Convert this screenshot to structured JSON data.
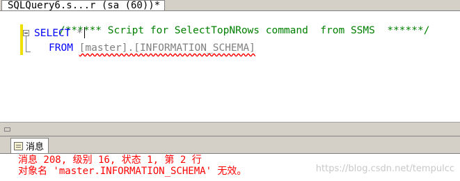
{
  "document_tab": {
    "title": "SQLQuery6.s...r (sa (60))*"
  },
  "editor": {
    "comment": "/****** Script for SelectTopNRows command  from SSMS  ******/",
    "select_keyword": "SELECT",
    "select_star": "*",
    "from_keyword": "FROM",
    "object_name": "[master].[INFORMATION_SCHEMA]"
  },
  "results": {
    "tab_label": "消息",
    "messages": [
      "消息 208, 级别 16, 状态 1, 第 2 行",
      "对象名 'master.INFORMATION_SCHEMA' 无效。"
    ],
    "message_color": "#ff0000"
  },
  "watermark": "https://blog.csdn.net/tempulcc",
  "colors": {
    "keyword": "#0000ff",
    "comment": "#008000",
    "identifier": "#808080",
    "error": "#ff0000",
    "change_bar": "#f0e000"
  }
}
